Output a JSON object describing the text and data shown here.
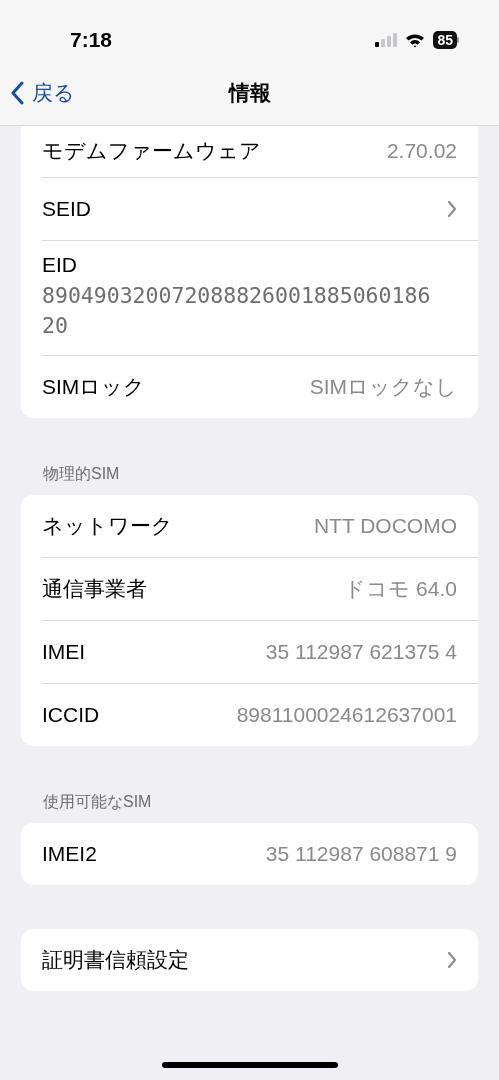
{
  "status_bar": {
    "time": "7:18",
    "battery": "85"
  },
  "nav": {
    "back": "戻る",
    "title": "情報"
  },
  "sections": [
    {
      "rows": [
        {
          "kind": "value",
          "label": "モデムファームウェア",
          "value": "2.70.02"
        },
        {
          "kind": "chevron",
          "label": "SEID"
        },
        {
          "kind": "multiline",
          "label": "EID",
          "value": "89049032007208882600188506018620"
        },
        {
          "kind": "value",
          "label": "SIMロック",
          "value": "SIMロックなし"
        }
      ]
    },
    {
      "header": "物理的SIM",
      "rows": [
        {
          "kind": "value",
          "label": "ネットワーク",
          "value": "NTT DOCOMO"
        },
        {
          "kind": "value",
          "label": "通信事業者",
          "value": "ドコモ 64.0"
        },
        {
          "kind": "value",
          "label": "IMEI",
          "value": "35 112987 621375 4"
        },
        {
          "kind": "value",
          "label": "ICCID",
          "value": "8981100024612637001"
        }
      ]
    },
    {
      "header": "使用可能なSIM",
      "rows": [
        {
          "kind": "value",
          "label": "IMEI2",
          "value": "35 112987 608871 9"
        }
      ]
    },
    {
      "rows": [
        {
          "kind": "chevron",
          "label": "証明書信頼設定"
        }
      ]
    }
  ]
}
